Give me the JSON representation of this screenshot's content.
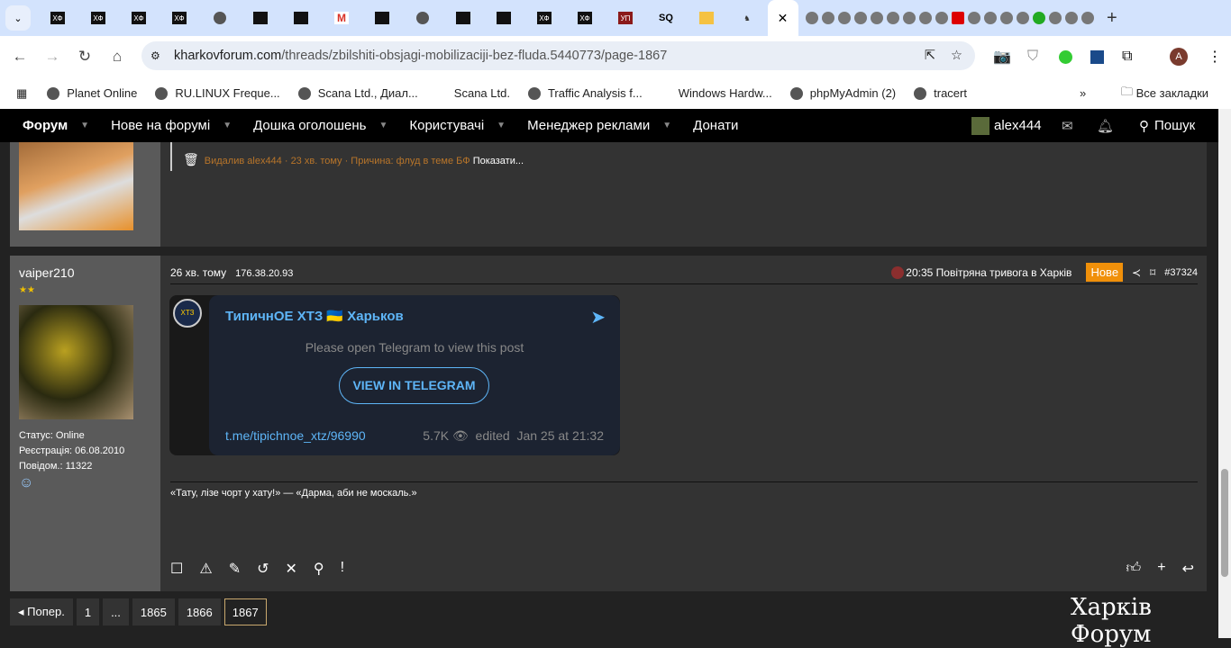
{
  "browser": {
    "tab_labels": [
      "ХФ",
      "ХФ",
      "ХФ",
      "ХФ",
      "ХФ",
      "ХФ",
      "УП",
      "SQ"
    ],
    "url_domain": "kharkovforum.com",
    "url_path": "/threads/zbilshiti-obsjagi-mobilizaciji-bez-fluda.5440773/page-1867",
    "bookmarks": [
      "Planet Online",
      "RU.LINUX Freque...",
      "Scana Ltd., Диал...",
      "Scana Ltd.",
      "Traffic Analysis f...",
      "Windows Hardw...",
      "phpMyAdmin (2)",
      "tracert"
    ],
    "all_bookmarks": "Все закладки",
    "profile": "A"
  },
  "nav": {
    "items": [
      "Форум",
      "Нове на форумі",
      "Дошка оголошень",
      "Користувачі",
      "Менеджер реклами",
      "Донати"
    ],
    "user": "alex444",
    "search": "Пошук"
  },
  "deleted_post": {
    "text": "Видалив alex444 · 23 хв. тому · Причина: флуд в теме БФ",
    "show": "Показати..."
  },
  "post": {
    "username": "vaiper210",
    "status": "Статус: Online",
    "registered": "Реєстрація: 06.08.2010",
    "posts": "Повідом.: 11322",
    "time": "26 хв. тому",
    "ip": "176.38.20.93",
    "alert": "20:35 Повітряна тривога в Харків",
    "badge": "Нове",
    "number": "#37324",
    "signature": "«Тату, лізе чорт у хату!» — «Дарма, аби не москаль.»",
    "telegram": {
      "channel": "ТипичнОЕ ХТЗ 🇺🇦 Харьков",
      "message": "Please open Telegram to view this post",
      "button": "VIEW IN TELEGRAM",
      "link": "t.me/tipichnoe_xtz/96990",
      "views": "5.7K",
      "edited": "edited  Jan 25 at 21:32",
      "logo": "ХТЗ"
    }
  },
  "pagination": {
    "prev": "◂ Попер.",
    "pages": [
      "1",
      "...",
      "1865",
      "1866",
      "1867"
    ]
  },
  "footer_logo": "Харків Форум"
}
